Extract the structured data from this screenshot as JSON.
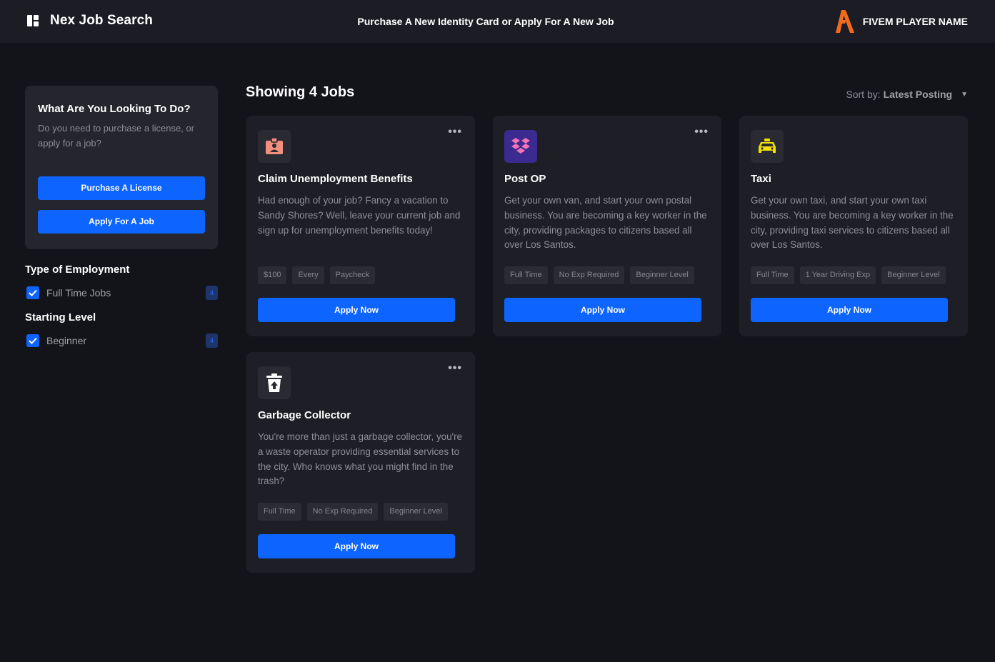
{
  "header": {
    "title": "Nex Job Search",
    "subtitle": "Purchase A New Identity Card or Apply For A New Job",
    "player_name": "FIVEM PLAYER NAME"
  },
  "sidebar": {
    "help_title": "What Are You Looking To Do?",
    "help_text": "Do you need to purchase a license, or apply for a job?",
    "purchase_label": "Purchase A License",
    "apply_label": "Apply For A Job",
    "filters": [
      {
        "title": "Type of Employment",
        "option": "Full Time Jobs",
        "count": "4",
        "checked": true
      },
      {
        "title": "Starting Level",
        "option": "Beginner",
        "count": "4",
        "checked": true
      }
    ]
  },
  "main": {
    "heading": "Showing 4 Jobs",
    "sort_label": "Sort by:",
    "sort_value": "Latest Posting",
    "sort_caret": "▼",
    "menu_glyph": "•••",
    "apply_label": "Apply Now",
    "jobs": [
      {
        "title": "Claim Unemployment Benefits",
        "icon": "id-badge-icon",
        "icon_color": "#f28f7e",
        "description": "Had enough of your job? Fancy a vacation to Sandy Shores? Well, leave your current job and sign up for unemployment benefits today!",
        "tags": [
          "$100",
          "Every",
          "Paycheck"
        ]
      },
      {
        "title": "Post OP",
        "icon": "box-icon",
        "icon_color": "#f472b6",
        "description": "Get your own van, and start your own postal business. You are becoming a key worker in the city, providing packages to citizens based all over Los Santos.",
        "tags": [
          "Full Time",
          "No Exp Required",
          "Beginner Level"
        ]
      },
      {
        "title": "Taxi",
        "icon": "taxi-icon",
        "icon_color": "#f5e000",
        "description": "Get your own taxi, and start your own taxi business. You are becoming a key worker in the city, providing taxi services to citizens based all over Los Santos.",
        "tags": [
          "Full Time",
          "1 Year Driving Exp",
          "Beginner Level"
        ]
      },
      {
        "title": "Garbage Collector",
        "icon": "trash-icon",
        "icon_color": "#ffffff",
        "description": "You're more than just a garbage collector, you're a waste operator providing essential services to the city. Who knows what you might find in the trash?",
        "tags": [
          "Full Time",
          "No Exp Required",
          "Beginner Level"
        ]
      }
    ]
  }
}
